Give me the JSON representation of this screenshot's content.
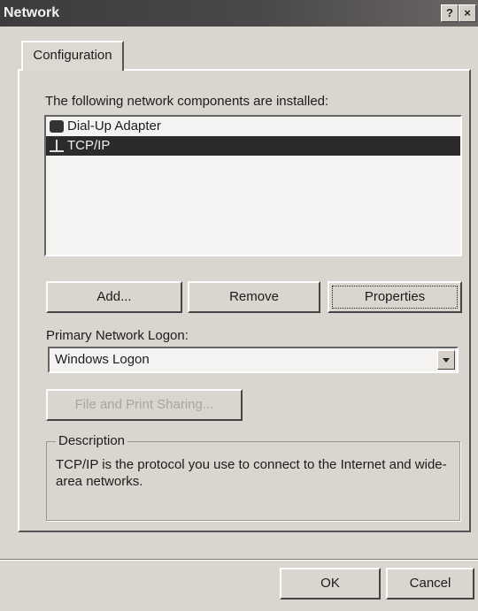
{
  "window": {
    "title": "Network",
    "help_button": "?",
    "close_button": "×"
  },
  "tabs": [
    {
      "label": "Configuration"
    }
  ],
  "components": {
    "label": "The following network components are installed:",
    "items": [
      {
        "label": "Dial-Up Adapter",
        "icon": "network-adapter-icon",
        "selected": false
      },
      {
        "label": "TCP/IP",
        "icon": "protocol-icon",
        "selected": true
      }
    ]
  },
  "buttons": {
    "add": "Add...",
    "remove": "Remove",
    "properties": "Properties"
  },
  "logon": {
    "label": "Primary Network Logon:",
    "selected": "Windows Logon"
  },
  "sharing_button": "File and Print Sharing...",
  "description": {
    "legend": "Description",
    "text": "TCP/IP is the protocol you use to connect to the Internet and wide-area networks."
  },
  "footer": {
    "ok": "OK",
    "cancel": "Cancel"
  }
}
